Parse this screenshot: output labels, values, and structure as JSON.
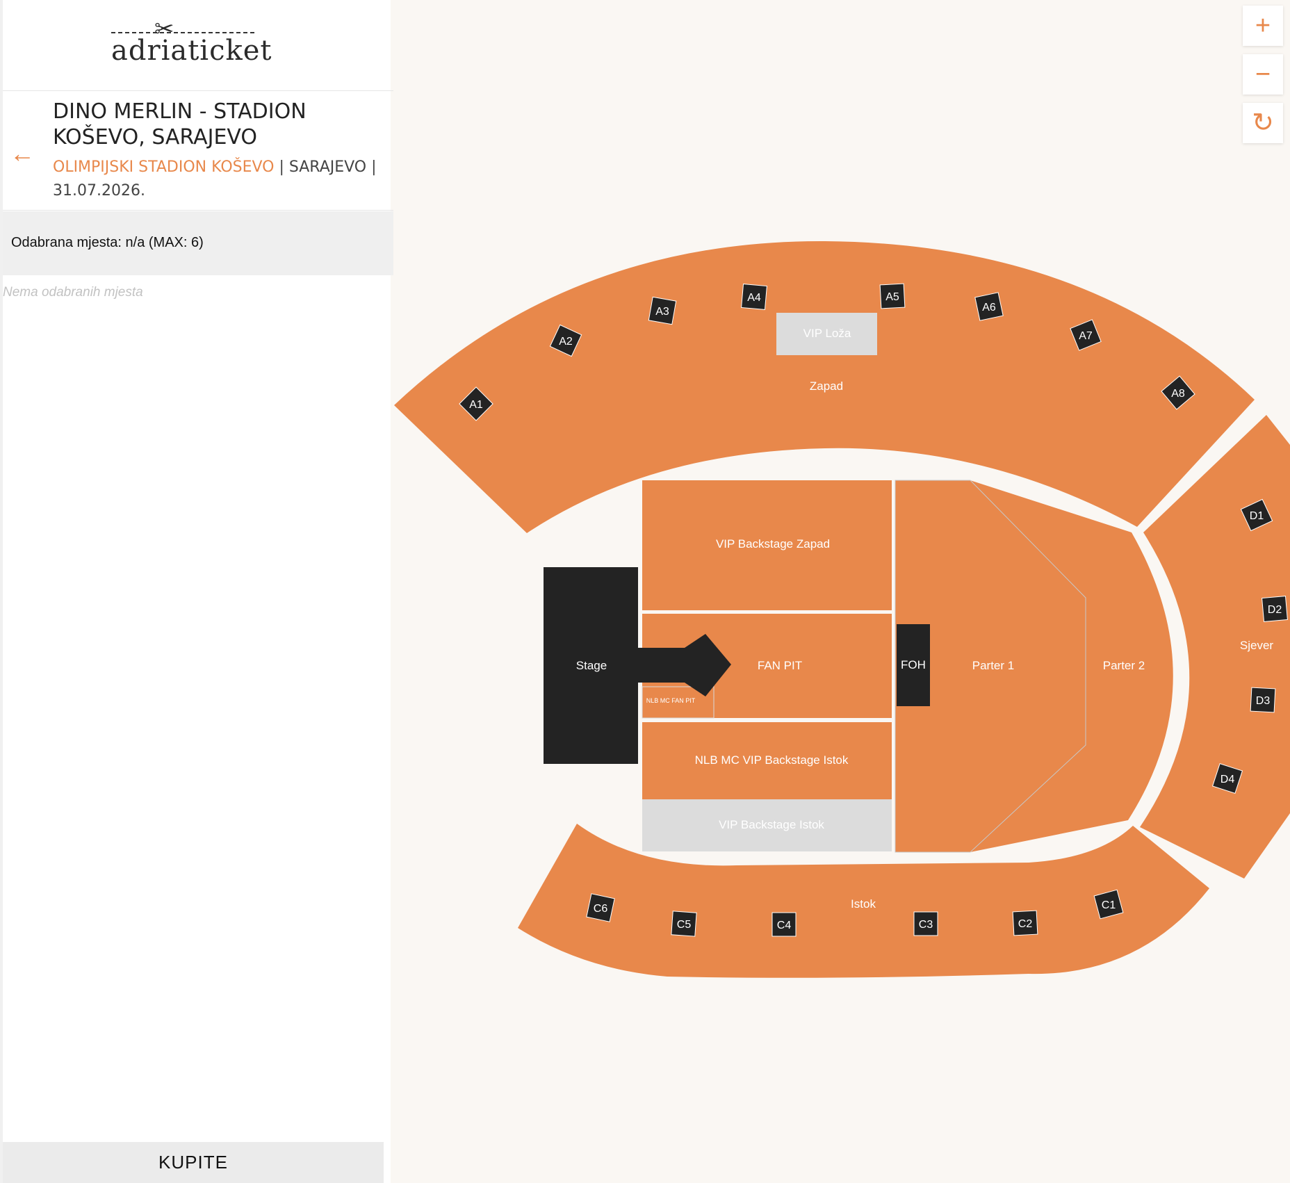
{
  "brand": {
    "logo_text": "adriaticket"
  },
  "event": {
    "title": "DINO MERLIN - STADION KOŠEVO, SARAJEVO",
    "venue": "OLIMPIJSKI STADION KOŠEVO",
    "city_separator": " | SARAJEVO | ",
    "date": "31.07.2026."
  },
  "selection": {
    "label": "Odabrana mjesta: n/a (MAX: 6)",
    "empty_text": "Nema odabranih mjesta"
  },
  "buy_button": {
    "label": "KUPITE"
  },
  "zoom": {
    "in_symbol": "+",
    "out_symbol": "−",
    "reset_symbol": "↻"
  },
  "colors": {
    "accent": "#e8884b",
    "section": "#e8884b",
    "disabled": "#dcdcdc",
    "dark": "#232323",
    "background": "#faf7f3"
  },
  "map": {
    "sections": {
      "zapad": "Zapad",
      "vip_loza": "VIP Loža",
      "vip_backstage_zapad": "VIP Backstage Zapad",
      "fan_pit": "FAN PIT",
      "nlb_mc_fan_pit": "NLB MC FAN PIT",
      "nlb_mc_vip_backstage_istok": "NLB MC VIP Backstage Istok",
      "vip_backstage_istok": "VIP Backstage Istok",
      "stage": "Stage",
      "foh": "FOH",
      "parter1": "Parter 1",
      "parter2": "Parter 2",
      "sjever": "Sjever",
      "istok": "Istok"
    },
    "entrances": {
      "A1": "A1",
      "A2": "A2",
      "A3": "A3",
      "A4": "A4",
      "A5": "A5",
      "A6": "A6",
      "A7": "A7",
      "A8": "A8",
      "C1": "C1",
      "C2": "C2",
      "C3": "C3",
      "C4": "C4",
      "C5": "C5",
      "C6": "C6",
      "D1": "D1",
      "D2": "D2",
      "D3": "D3",
      "D4": "D4"
    }
  }
}
